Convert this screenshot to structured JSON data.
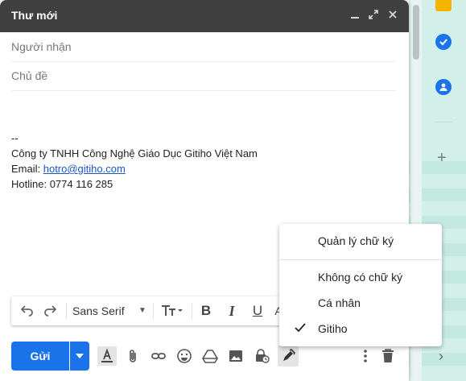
{
  "compose": {
    "title": "Thư mới",
    "recipients_placeholder": "Người nhận",
    "subject_placeholder": "Chủ đề",
    "signature": {
      "separator": "--",
      "company": "Công ty TNHH Công Nghệ Giáo Dục Gitiho Việt Nam",
      "email_label": "Email: ",
      "email": "hotro@gitiho.com",
      "hotline": "Hotline: 0774 116 285"
    }
  },
  "toolbar": {
    "font": "Sans Serif"
  },
  "send": {
    "label": "Gửi"
  },
  "signature_menu": {
    "manage": "Quản lý chữ ký",
    "none": "Không có chữ ký",
    "personal": "Cá nhân",
    "gitiho": "Gitiho",
    "selected": "Gitiho"
  },
  "colors": {
    "titlebar": "#404040",
    "send": "#1a73e8",
    "link": "#1a57c9",
    "side": "#d3efe9"
  }
}
